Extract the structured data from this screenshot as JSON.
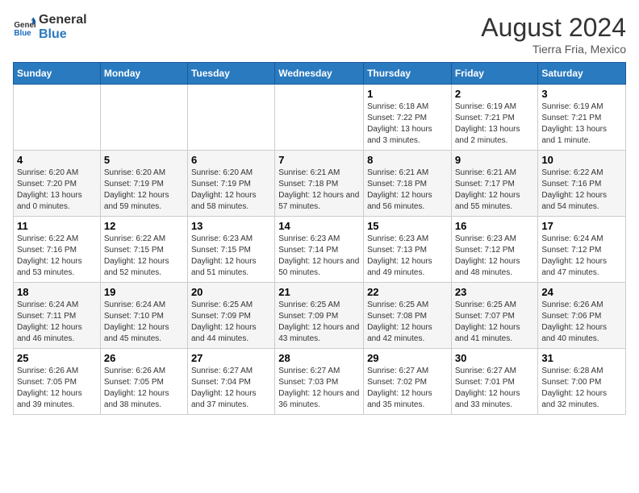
{
  "logo": {
    "line1": "General",
    "line2": "Blue"
  },
  "title": "August 2024",
  "location": "Tierra Fria, Mexico",
  "weekdays": [
    "Sunday",
    "Monday",
    "Tuesday",
    "Wednesday",
    "Thursday",
    "Friday",
    "Saturday"
  ],
  "weeks": [
    [
      {
        "day": "",
        "info": ""
      },
      {
        "day": "",
        "info": ""
      },
      {
        "day": "",
        "info": ""
      },
      {
        "day": "",
        "info": ""
      },
      {
        "day": "1",
        "info": "Sunrise: 6:18 AM\nSunset: 7:22 PM\nDaylight: 13 hours and 3 minutes."
      },
      {
        "day": "2",
        "info": "Sunrise: 6:19 AM\nSunset: 7:21 PM\nDaylight: 13 hours and 2 minutes."
      },
      {
        "day": "3",
        "info": "Sunrise: 6:19 AM\nSunset: 7:21 PM\nDaylight: 13 hours and 1 minute."
      }
    ],
    [
      {
        "day": "4",
        "info": "Sunrise: 6:20 AM\nSunset: 7:20 PM\nDaylight: 13 hours and 0 minutes."
      },
      {
        "day": "5",
        "info": "Sunrise: 6:20 AM\nSunset: 7:19 PM\nDaylight: 12 hours and 59 minutes."
      },
      {
        "day": "6",
        "info": "Sunrise: 6:20 AM\nSunset: 7:19 PM\nDaylight: 12 hours and 58 minutes."
      },
      {
        "day": "7",
        "info": "Sunrise: 6:21 AM\nSunset: 7:18 PM\nDaylight: 12 hours and 57 minutes."
      },
      {
        "day": "8",
        "info": "Sunrise: 6:21 AM\nSunset: 7:18 PM\nDaylight: 12 hours and 56 minutes."
      },
      {
        "day": "9",
        "info": "Sunrise: 6:21 AM\nSunset: 7:17 PM\nDaylight: 12 hours and 55 minutes."
      },
      {
        "day": "10",
        "info": "Sunrise: 6:22 AM\nSunset: 7:16 PM\nDaylight: 12 hours and 54 minutes."
      }
    ],
    [
      {
        "day": "11",
        "info": "Sunrise: 6:22 AM\nSunset: 7:16 PM\nDaylight: 12 hours and 53 minutes."
      },
      {
        "day": "12",
        "info": "Sunrise: 6:22 AM\nSunset: 7:15 PM\nDaylight: 12 hours and 52 minutes."
      },
      {
        "day": "13",
        "info": "Sunrise: 6:23 AM\nSunset: 7:15 PM\nDaylight: 12 hours and 51 minutes."
      },
      {
        "day": "14",
        "info": "Sunrise: 6:23 AM\nSunset: 7:14 PM\nDaylight: 12 hours and 50 minutes."
      },
      {
        "day": "15",
        "info": "Sunrise: 6:23 AM\nSunset: 7:13 PM\nDaylight: 12 hours and 49 minutes."
      },
      {
        "day": "16",
        "info": "Sunrise: 6:23 AM\nSunset: 7:12 PM\nDaylight: 12 hours and 48 minutes."
      },
      {
        "day": "17",
        "info": "Sunrise: 6:24 AM\nSunset: 7:12 PM\nDaylight: 12 hours and 47 minutes."
      }
    ],
    [
      {
        "day": "18",
        "info": "Sunrise: 6:24 AM\nSunset: 7:11 PM\nDaylight: 12 hours and 46 minutes."
      },
      {
        "day": "19",
        "info": "Sunrise: 6:24 AM\nSunset: 7:10 PM\nDaylight: 12 hours and 45 minutes."
      },
      {
        "day": "20",
        "info": "Sunrise: 6:25 AM\nSunset: 7:09 PM\nDaylight: 12 hours and 44 minutes."
      },
      {
        "day": "21",
        "info": "Sunrise: 6:25 AM\nSunset: 7:09 PM\nDaylight: 12 hours and 43 minutes."
      },
      {
        "day": "22",
        "info": "Sunrise: 6:25 AM\nSunset: 7:08 PM\nDaylight: 12 hours and 42 minutes."
      },
      {
        "day": "23",
        "info": "Sunrise: 6:25 AM\nSunset: 7:07 PM\nDaylight: 12 hours and 41 minutes."
      },
      {
        "day": "24",
        "info": "Sunrise: 6:26 AM\nSunset: 7:06 PM\nDaylight: 12 hours and 40 minutes."
      }
    ],
    [
      {
        "day": "25",
        "info": "Sunrise: 6:26 AM\nSunset: 7:05 PM\nDaylight: 12 hours and 39 minutes."
      },
      {
        "day": "26",
        "info": "Sunrise: 6:26 AM\nSunset: 7:05 PM\nDaylight: 12 hours and 38 minutes."
      },
      {
        "day": "27",
        "info": "Sunrise: 6:27 AM\nSunset: 7:04 PM\nDaylight: 12 hours and 37 minutes."
      },
      {
        "day": "28",
        "info": "Sunrise: 6:27 AM\nSunset: 7:03 PM\nDaylight: 12 hours and 36 minutes."
      },
      {
        "day": "29",
        "info": "Sunrise: 6:27 AM\nSunset: 7:02 PM\nDaylight: 12 hours and 35 minutes."
      },
      {
        "day": "30",
        "info": "Sunrise: 6:27 AM\nSunset: 7:01 PM\nDaylight: 12 hours and 33 minutes."
      },
      {
        "day": "31",
        "info": "Sunrise: 6:28 AM\nSunset: 7:00 PM\nDaylight: 12 hours and 32 minutes."
      }
    ]
  ]
}
